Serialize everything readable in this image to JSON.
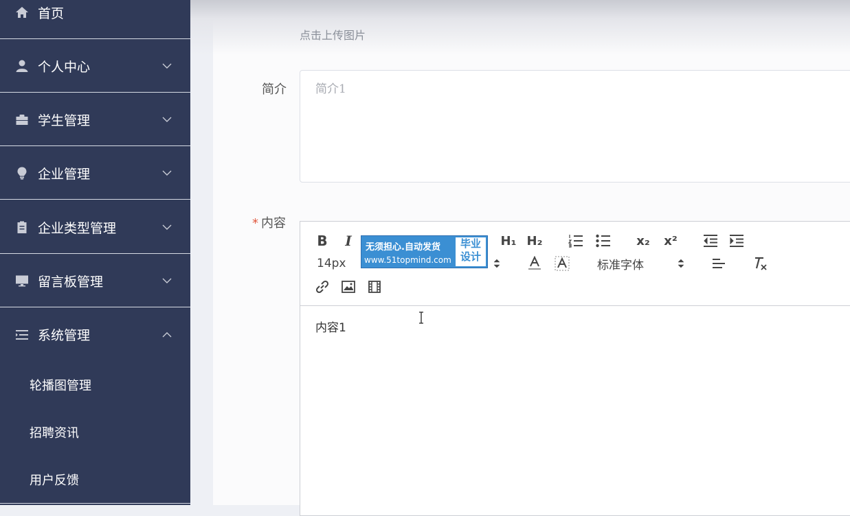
{
  "sidebar": {
    "items": [
      {
        "label": "首页",
        "icon": "home-icon"
      },
      {
        "label": "个人中心",
        "icon": "user-icon"
      },
      {
        "label": "学生管理",
        "icon": "briefcase-icon"
      },
      {
        "label": "企业管理",
        "icon": "bulb-icon"
      },
      {
        "label": "企业类型管理",
        "icon": "clipboard-icon"
      },
      {
        "label": "留言板管理",
        "icon": "monitor-icon"
      },
      {
        "label": "系统管理",
        "icon": "menu-lines-icon",
        "expanded": true
      }
    ],
    "subitems": [
      {
        "label": "轮播图管理"
      },
      {
        "label": "招聘资讯"
      },
      {
        "label": "用户反馈"
      }
    ]
  },
  "form": {
    "upload_hint": "点击上传图片",
    "intro_label": "简介",
    "intro_placeholder": "简介1",
    "content_required_mark": "*",
    "content_label": "内容",
    "content_value": "内容1"
  },
  "toolbar": {
    "bold": "B",
    "italic": "I",
    "h1": "H₁",
    "h2": "H₂",
    "subscript": "x₂",
    "superscript": "x²",
    "font_size": "14px",
    "font_family": "标准字体"
  },
  "watermark": {
    "line1": "无须担心.自动发货",
    "line2": "www.51topmind.com",
    "box_line1": "毕业",
    "box_line2": "设计"
  },
  "colors": {
    "sidebar_bg": "#303a58",
    "accent": "#3b8fd3",
    "required": "#e0573d"
  }
}
